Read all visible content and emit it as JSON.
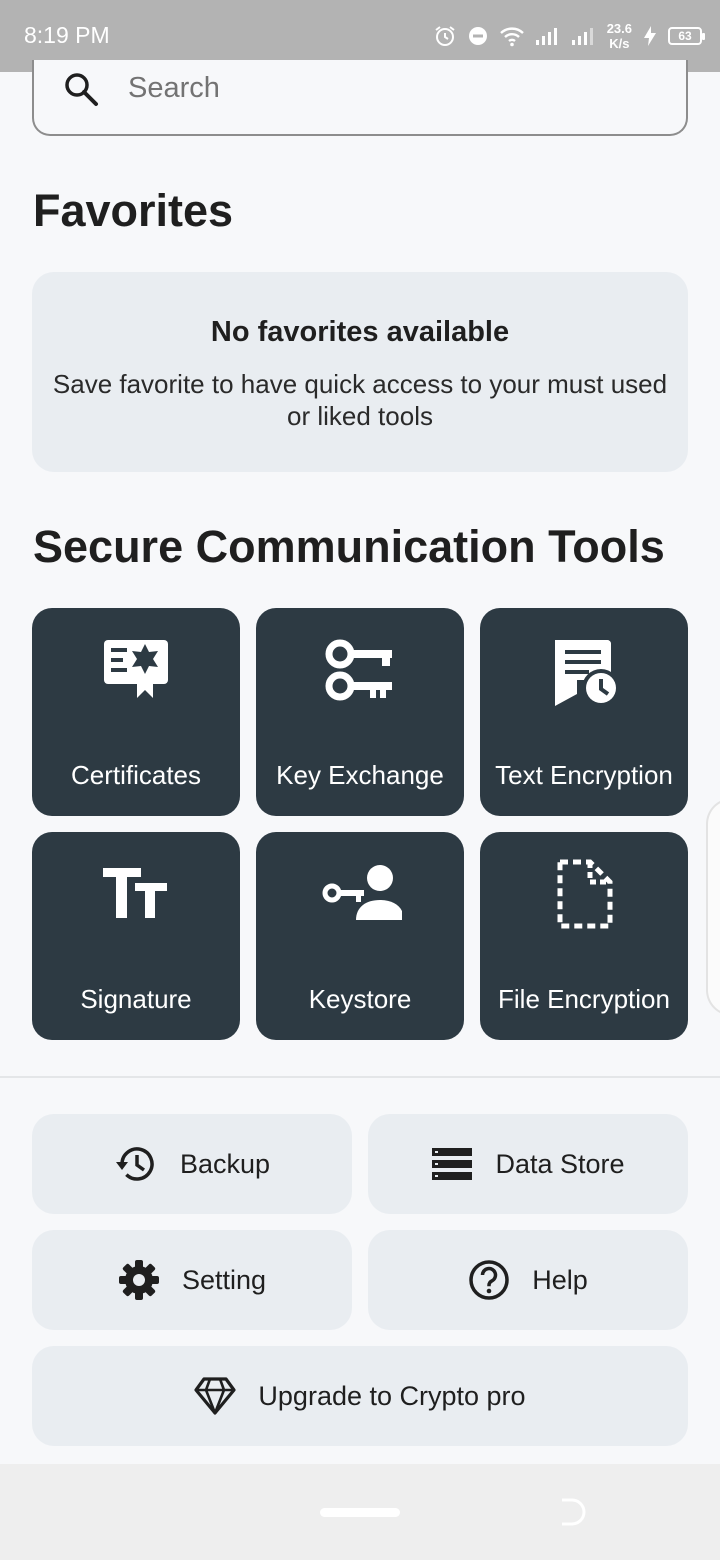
{
  "status_bar": {
    "time": "8:19 PM",
    "net_speed_value": "23.6",
    "net_speed_unit": "K/s",
    "battery": "63"
  },
  "search": {
    "placeholder": "Search"
  },
  "favorites": {
    "title": "Favorites",
    "empty_title": "No favorites available",
    "empty_desc": "Save favorite to have quick access to your must used or liked tools"
  },
  "tools": {
    "title": "Secure Communication Tools",
    "items": [
      {
        "label": "Certificates",
        "icon": "certificate-icon"
      },
      {
        "label": "Key Exchange",
        "icon": "keys-icon"
      },
      {
        "label": "Text Encryption",
        "icon": "document-clock-icon"
      },
      {
        "label": "Signature",
        "icon": "text-size-icon"
      },
      {
        "label": "Keystore",
        "icon": "key-person-icon"
      },
      {
        "label": "File Encryption",
        "icon": "dashed-file-icon"
      }
    ]
  },
  "actions": {
    "backup": "Backup",
    "data_store": "Data Store",
    "setting": "Setting",
    "help": "Help",
    "upgrade": "Upgrade to Crypto pro"
  },
  "colors": {
    "tile_bg": "#2d3a43",
    "card_bg": "#e9edf1",
    "page_bg": "#f7f8fa",
    "status_bar": "#b3b3b3"
  }
}
